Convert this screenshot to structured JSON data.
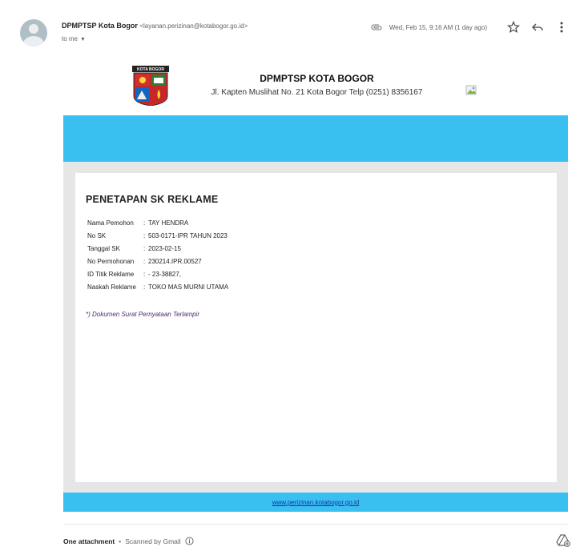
{
  "email": {
    "sender_name": "DPMPTSP Kota Bogor",
    "sender_email": "<layanan.perizinan@kotabogor.go.id>",
    "to": "to me",
    "date": "Wed, Feb 15, 9:16 AM (1 day ago)",
    "icons": [
      "attachment-clip-icon",
      "star-icon",
      "reply-icon",
      "more-vert-icon"
    ]
  },
  "letterhead": {
    "logo_text": "KOTA BOGOR",
    "org_name": "DPMPTSP KOTA BOGOR",
    "address": "Jl. Kapten Muslihat No. 21 Kota Bogor Telp (0251) 8356167"
  },
  "document": {
    "title": "PENETAPAN SK REKLAME",
    "fields": [
      {
        "label": "Nama Pemohon",
        "value": "TAY HENDRA"
      },
      {
        "label": "No SK",
        "value": "503-0171-IPR TAHUN 2023"
      },
      {
        "label": "Tanggal SK",
        "value": "2023-02-15"
      },
      {
        "label": "No Permohonan",
        "value": "230214.IPR.00527"
      },
      {
        "label": "ID Titik Reklame",
        "value": "- 23-38827,"
      },
      {
        "label": "Naskah Reklame",
        "value": "TOKO MAS MURNI UTAMA"
      }
    ],
    "note": "*) Dokumen Surat Pernyataan Terlampir",
    "footer_link": "www.perizinan.kotabogor.go.id"
  },
  "attachments": {
    "label": "One attachment",
    "separator": "•",
    "scanned": "Scanned by Gmail"
  },
  "colors": {
    "banner": "#39c0f0",
    "frame": "#e6e6e6",
    "link": "#1a33a0"
  }
}
